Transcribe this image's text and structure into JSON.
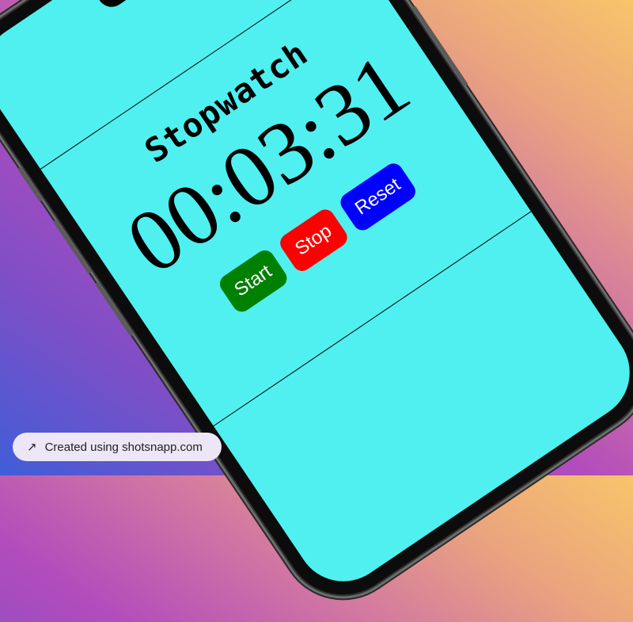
{
  "app": {
    "title": "Stopwatch",
    "time": "00:03:31",
    "buttons": {
      "start": "Start",
      "stop": "Stop",
      "reset": "Reset"
    },
    "colors": {
      "screen_bg": "#50f0f0",
      "start": "#008000",
      "stop": "#ff0000",
      "reset": "#0000ff"
    }
  },
  "badge": {
    "icon": "arrow-up-right-icon",
    "text": "Created using shotsnapp.com"
  }
}
